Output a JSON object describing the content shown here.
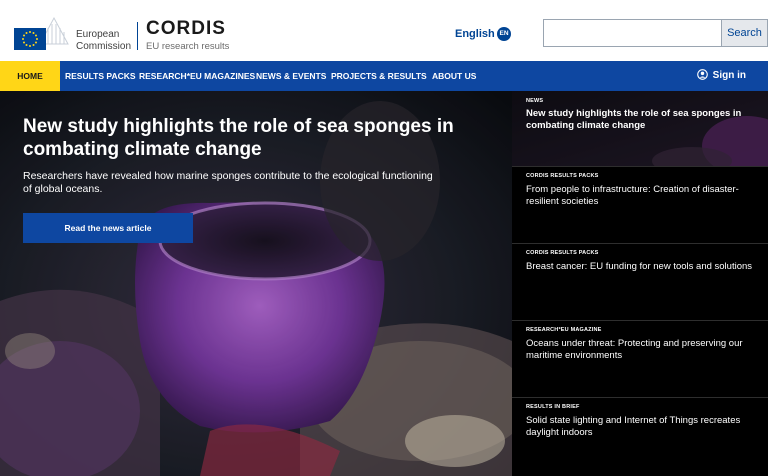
{
  "header": {
    "ec_line1": "European",
    "ec_line2": "Commission",
    "site_title": "CORDIS",
    "site_subtitle": "EU research results",
    "language": "English",
    "language_code": "EN",
    "search_placeholder": "",
    "search_button": "Search"
  },
  "nav": {
    "items": [
      "HOME",
      "RESULTS PACKS",
      "RESEARCH*EU MAGAZINES",
      "NEWS & EVENTS",
      "PROJECTS & RESULTS",
      "ABOUT US"
    ],
    "sign_in": "Sign in"
  },
  "hero": {
    "title": "New study highlights the role of sea sponges in combating climate change",
    "description": "Researchers have revealed how marine sponges contribute to the ecological functioning of global oceans.",
    "button": "Read the news article"
  },
  "side": {
    "cards": [
      {
        "category": "NEWS",
        "title": "New study highlights the role of sea sponges in combating climate change"
      },
      {
        "category": "CORDIS RESULTS PACKS",
        "title": "From people to infrastructure: Creation of disaster-resilient societies"
      },
      {
        "category": "CORDIS RESULTS PACKS",
        "title": "Breast cancer: EU funding for new tools and solutions"
      },
      {
        "category": "RESEARCH*EU MAGAZINE",
        "title": "Oceans under threat: Protecting and preserving our maritime environments"
      },
      {
        "category": "RESULTS IN BRIEF",
        "title": "Solid state lighting and Internet of Things recreates daylight indoors"
      }
    ]
  },
  "colors": {
    "nav_blue": "#0e47a1",
    "home_yellow": "#ffd617",
    "ec_blue": "#004494"
  }
}
